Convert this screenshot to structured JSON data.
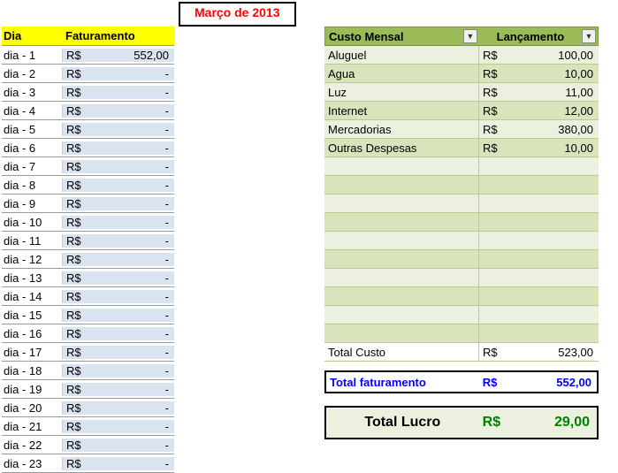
{
  "title": "Março de 2013",
  "headers": {
    "dia": "Dia",
    "faturamento": "Faturamento",
    "custo_mensal": "Custo Mensal",
    "lancamento": "Lançamento"
  },
  "currency": "R$",
  "dash": "-",
  "dias": [
    {
      "label": "dia - 1",
      "val": "552,00"
    },
    {
      "label": "dia - 2",
      "val": "-"
    },
    {
      "label": "dia - 3",
      "val": "-"
    },
    {
      "label": "dia - 4",
      "val": "-"
    },
    {
      "label": "dia - 5",
      "val": "-"
    },
    {
      "label": "dia - 6",
      "val": "-"
    },
    {
      "label": "dia - 7",
      "val": "-"
    },
    {
      "label": "dia - 8",
      "val": "-"
    },
    {
      "label": "dia - 9",
      "val": "-"
    },
    {
      "label": "dia - 10",
      "val": "-"
    },
    {
      "label": "dia - 11",
      "val": "-"
    },
    {
      "label": "dia - 12",
      "val": "-"
    },
    {
      "label": "dia - 13",
      "val": "-"
    },
    {
      "label": "dia - 14",
      "val": "-"
    },
    {
      "label": "dia - 15",
      "val": "-"
    },
    {
      "label": "dia - 16",
      "val": "-"
    },
    {
      "label": "dia - 17",
      "val": "-"
    },
    {
      "label": "dia - 18",
      "val": "-"
    },
    {
      "label": "dia - 19",
      "val": "-"
    },
    {
      "label": "dia - 20",
      "val": "-"
    },
    {
      "label": "dia - 21",
      "val": "-"
    },
    {
      "label": "dia - 22",
      "val": "-"
    },
    {
      "label": "dia - 23",
      "val": "-"
    }
  ],
  "custos": [
    {
      "label": "Aluguel",
      "val": "100,00"
    },
    {
      "label": "Agua",
      "val": "10,00"
    },
    {
      "label": "Luz",
      "val": "11,00"
    },
    {
      "label": "Internet",
      "val": "12,00"
    },
    {
      "label": "Mercadorias",
      "val": "380,00"
    },
    {
      "label": "Outras Despesas",
      "val": "10,00"
    },
    {
      "label": "",
      "val": ""
    },
    {
      "label": "",
      "val": ""
    },
    {
      "label": "",
      "val": ""
    },
    {
      "label": "",
      "val": ""
    },
    {
      "label": "",
      "val": ""
    },
    {
      "label": "",
      "val": ""
    },
    {
      "label": "",
      "val": ""
    },
    {
      "label": "",
      "val": ""
    },
    {
      "label": "",
      "val": ""
    },
    {
      "label": "",
      "val": ""
    }
  ],
  "total_custo": {
    "label": "Total Custo",
    "val": "523,00"
  },
  "total_fat": {
    "label": "Total faturamento",
    "val": "552,00"
  },
  "total_lucro": {
    "label": "Total Lucro",
    "val": "29,00"
  }
}
